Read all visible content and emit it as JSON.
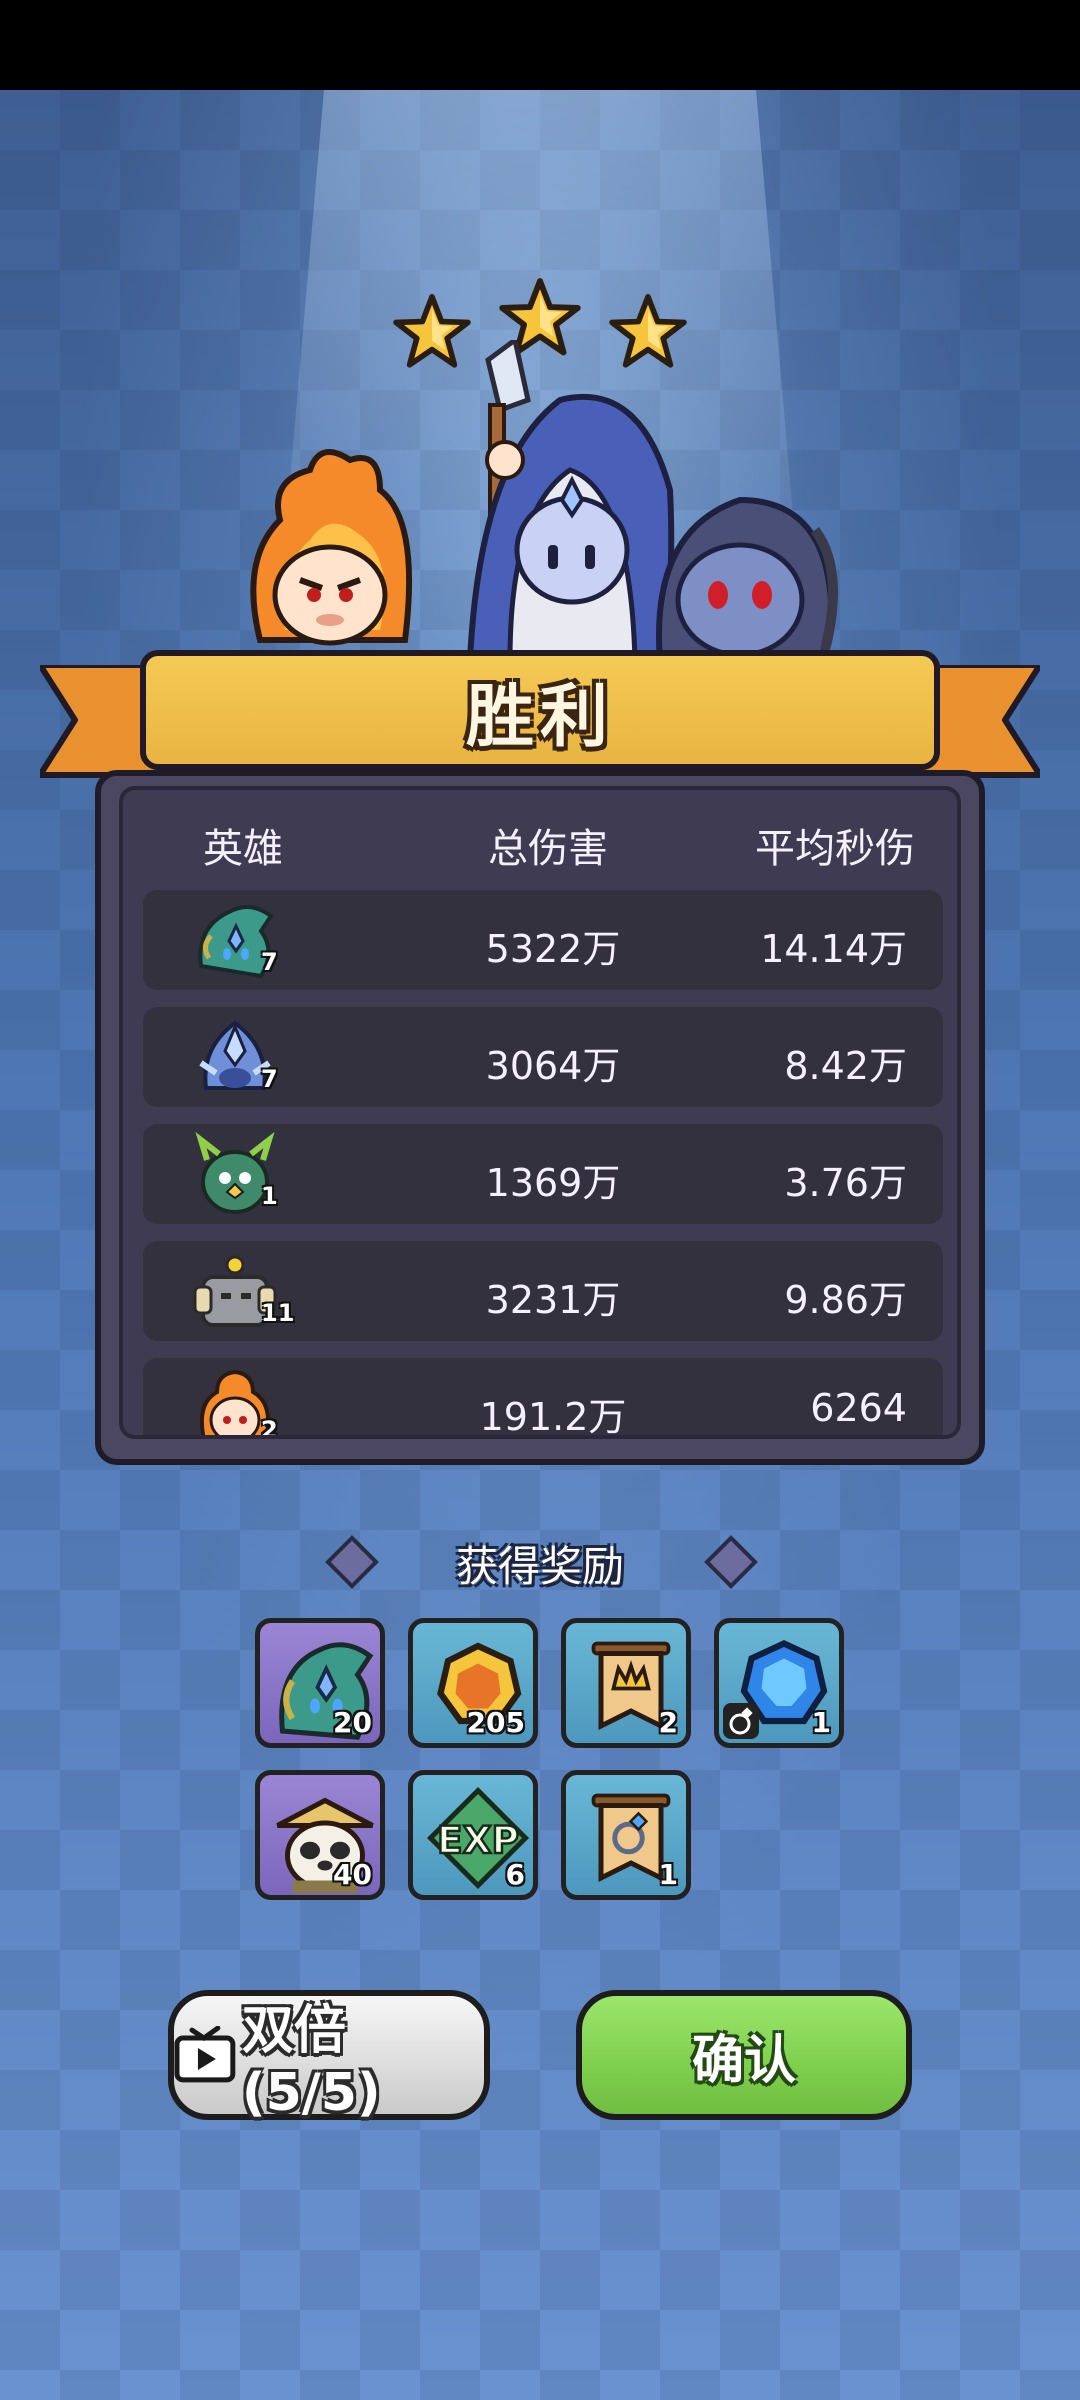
{
  "result": {
    "title": "胜利",
    "stars_earned": 3,
    "stars_total": 3
  },
  "table": {
    "headers": {
      "hero": "英雄",
      "total_damage": "总伤害",
      "avg_dps": "平均秒伤"
    },
    "rows": [
      {
        "hero_icon": "teal-crystal-hero",
        "level": "7",
        "total_damage": "5322万",
        "avg_dps": "14.14万"
      },
      {
        "hero_icon": "blue-crystal-mage",
        "level": "7",
        "total_damage": "3064万",
        "avg_dps": "8.42万"
      },
      {
        "hero_icon": "green-owl-beast",
        "level": "1",
        "total_damage": "1369万",
        "avg_dps": "3.76万"
      },
      {
        "hero_icon": "stone-golem",
        "level": "11",
        "total_damage": "3231万",
        "avg_dps": "9.86万"
      },
      {
        "hero_icon": "fire-monkey",
        "level": "2",
        "total_damage": "191.2万",
        "avg_dps": "6264"
      }
    ]
  },
  "rewards": {
    "title": "获得奖励",
    "items": [
      {
        "icon": "teal-hero-shard",
        "count": "20"
      },
      {
        "icon": "gold-coin",
        "count": "205"
      },
      {
        "icon": "crown-banner",
        "count": "2"
      },
      {
        "icon": "blue-gem",
        "count": "1"
      },
      {
        "icon": "panda-hero-shard",
        "count": "40"
      },
      {
        "icon": "exp-token",
        "count": "6"
      },
      {
        "icon": "ring-banner",
        "count": "1"
      }
    ]
  },
  "buttons": {
    "double_label": "双倍(5/5)",
    "confirm_label": "确认"
  },
  "colors": {
    "ribbon": "#f0c24c",
    "panel": "#4b4760",
    "confirm": "#7fcf4e",
    "background": "#4a6fa8"
  }
}
